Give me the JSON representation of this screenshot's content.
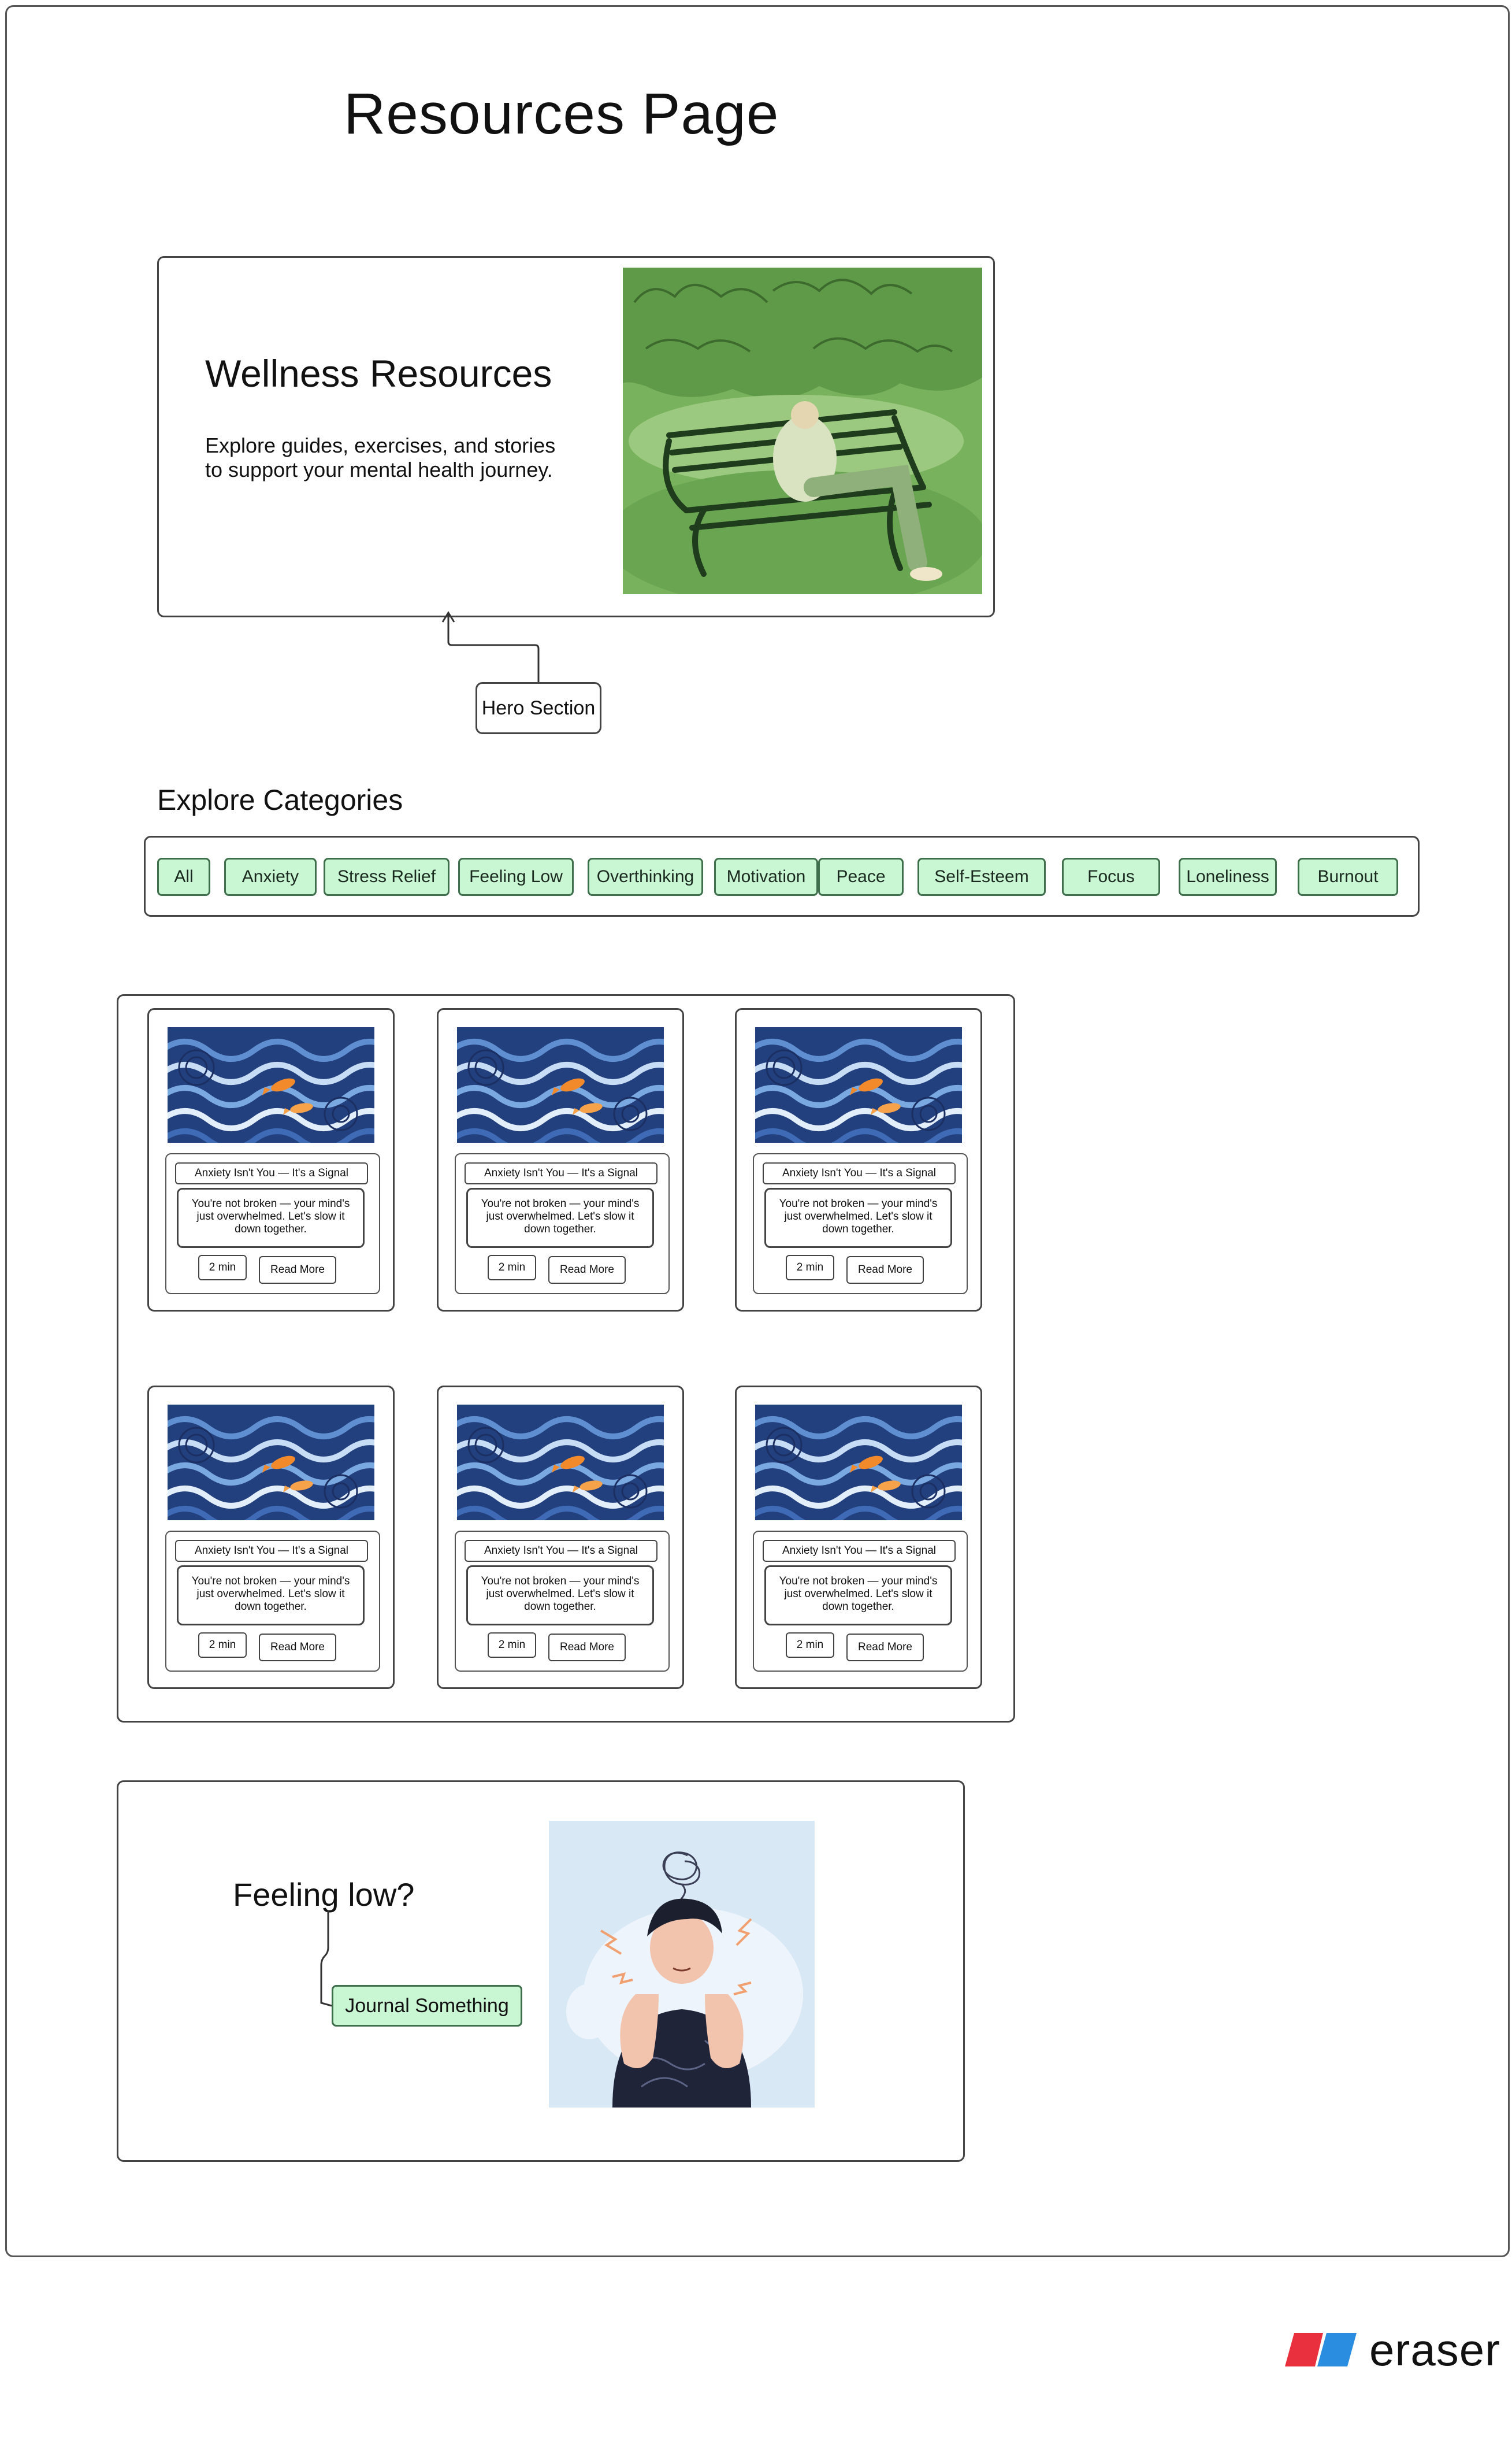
{
  "page_title": "Resources Page",
  "hero": {
    "title": "Wellness Resources",
    "description": "Explore guides, exercises, and stories to support your mental health journey.",
    "image_icon": "park-bench-illustration-icon",
    "annotation": "Hero Section"
  },
  "categories": {
    "heading": "Explore Categories",
    "items": [
      {
        "label": "All"
      },
      {
        "label": "Anxiety"
      },
      {
        "label": "Stress Relief"
      },
      {
        "label": "Feeling Low"
      },
      {
        "label": "Overthinking"
      },
      {
        "label": "Motivation"
      },
      {
        "label": "Peace"
      },
      {
        "label": "Self-Esteem"
      },
      {
        "label": "Focus"
      },
      {
        "label": "Loneliness"
      },
      {
        "label": "Burnout"
      }
    ]
  },
  "cards": [
    {
      "title": "Anxiety Isn't You — It's a Signal",
      "body": "You're not broken — your mind's just overwhelmed. Let's slow it down together.",
      "time": "2 min",
      "action": "Read More"
    },
    {
      "title": "Anxiety Isn't You — It's a Signal",
      "body": "You're not broken — your mind's just overwhelmed. Let's slow it down together.",
      "time": "2 min",
      "action": "Read More"
    },
    {
      "title": "Anxiety Isn't You — It's a Signal",
      "body": "You're not broken — your mind's just overwhelmed. Let's slow it down together.",
      "time": "2 min",
      "action": "Read More"
    },
    {
      "title": "Anxiety Isn't You — It's a Signal",
      "body": "You're not broken — your mind's just overwhelmed. Let's slow it down together.",
      "time": "2 min",
      "action": "Read More"
    },
    {
      "title": "Anxiety Isn't You — It's a Signal",
      "body": "You're not broken — your mind's just overwhelmed. Let's slow it down together.",
      "time": "2 min",
      "action": "Read More"
    },
    {
      "title": "Anxiety Isn't You — It's a Signal",
      "body": "You're not broken — your mind's just overwhelmed. Let's slow it down together.",
      "time": "2 min",
      "action": "Read More"
    }
  ],
  "feeling_low": {
    "title": "Feeling low?",
    "button": "Journal Something",
    "image_icon": "stressed-person-illustration-icon"
  },
  "brand": {
    "logo_text": "eraser",
    "logo_colors": [
      "#e9303f",
      "#2a8de0"
    ]
  },
  "colors": {
    "chip_fill": "#c9f6d3",
    "chip_border": "#3f6f4c"
  }
}
